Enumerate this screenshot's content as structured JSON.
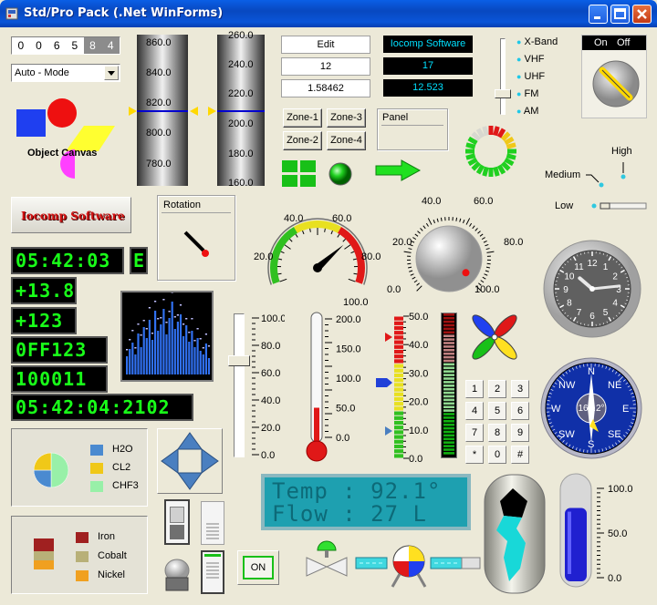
{
  "window": {
    "title": "Std/Pro Pack (.Net WinForms)"
  },
  "odometer": {
    "digits": [
      "0",
      "0",
      "6",
      "5",
      "8",
      "4"
    ]
  },
  "mode_select": {
    "value": "Auto - Mode"
  },
  "object_canvas": {
    "label": "Object Canvas"
  },
  "slider_a": {
    "ticks": [
      "860.0",
      "840.0",
      "820.0",
      "800.0",
      "780.0"
    ]
  },
  "slider_b": {
    "ticks": [
      "260.0",
      "240.0",
      "220.0",
      "200.0",
      "180.0",
      "160.0"
    ]
  },
  "edits": {
    "edit": "Edit",
    "value1": "12",
    "value2": "1.58462"
  },
  "lcds": {
    "company": "Iocomp Software",
    "value1": "17",
    "value2": "12.523"
  },
  "band_switch": {
    "options": [
      "X-Band",
      "VHF",
      "UHF",
      "FM",
      "AM"
    ]
  },
  "onoff": {
    "on": "On",
    "off": "Off"
  },
  "zones": [
    "Zone-1",
    "Zone-3",
    "Zone-2",
    "Zone-4"
  ],
  "panel_label": "Panel",
  "iocomp_label": "Iocomp Software",
  "rotation": {
    "label": "Rotation"
  },
  "gauge": {
    "ticks": [
      "20.0",
      "40.0",
      "60.0",
      "80.0",
      "100.0"
    ],
    "value": 72
  },
  "knob": {
    "ticks": [
      "0.0",
      "20.0",
      "40.0",
      "60.0",
      "80.0",
      "100.0"
    ],
    "value": 98
  },
  "selector": {
    "high": "High",
    "medium": "Medium",
    "low": "Low"
  },
  "leds": {
    "time1": "05:42:03",
    "suffix": "E",
    "val1": "+13.8",
    "val2": "+123",
    "hex": "0FF123",
    "bin": "100011",
    "time2": "05:42:04:2102"
  },
  "slider_vert": {
    "ticks": [
      "100.0",
      "80.0",
      "60.0",
      "40.0",
      "20.0",
      "0.0"
    ],
    "value": 70
  },
  "thermometer": {
    "ticks": [
      "200.0",
      "150.0",
      "100.0",
      "50.0",
      "0.0"
    ],
    "value": 50
  },
  "bar_scale": {
    "ticks": [
      "50.0",
      "40.0",
      "30.0",
      "20.0",
      "10.0",
      "0.0"
    ]
  },
  "keypad": {
    "keys": [
      "1",
      "2",
      "3",
      "4",
      "5",
      "6",
      "7",
      "8",
      "9",
      "*",
      "0",
      "#"
    ]
  },
  "clock": {
    "numbers": [
      "12",
      "1",
      "2",
      "3",
      "4",
      "5",
      "6",
      "7",
      "8",
      "9",
      "10",
      "11"
    ]
  },
  "compass": {
    "n": "N",
    "ne": "NE",
    "e": "E",
    "se": "SE",
    "s": "S",
    "sw": "SW",
    "w": "W",
    "nw": "NW",
    "heading": "165.2°"
  },
  "pie_legend": [
    {
      "label": "H2O",
      "color": "#4a8ad0"
    },
    {
      "label": "CL2",
      "color": "#f0c818"
    },
    {
      "label": "CHF3",
      "color": "#98f0a8"
    }
  ],
  "bar_legend": [
    {
      "label": "Iron",
      "color": "#a02020"
    },
    {
      "label": "Cobalt",
      "color": "#b8b078"
    },
    {
      "label": "Nickel",
      "color": "#f0a020"
    }
  ],
  "matrix": {
    "line1": "Temp : 92.1°",
    "line2": "Flow : 27 L"
  },
  "tube": {
    "ticks": [
      "100.0",
      "50.0",
      "0.0"
    ],
    "value": 78
  },
  "on_button": {
    "label": "ON"
  }
}
